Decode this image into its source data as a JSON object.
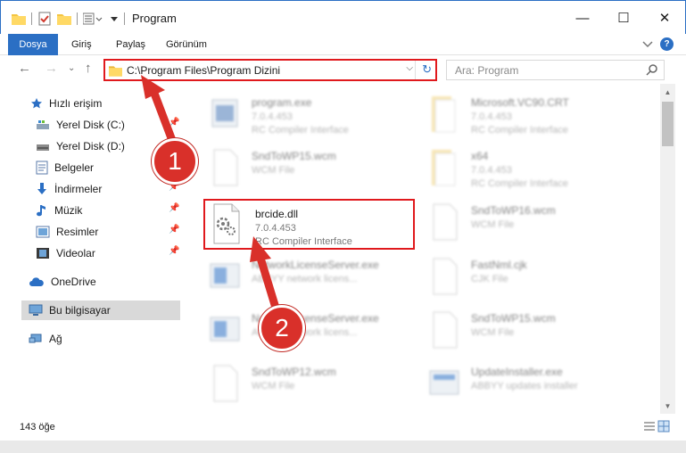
{
  "window": {
    "title": "Program",
    "controls": {
      "minimize": "—",
      "maximize": "☐",
      "close": "✕"
    }
  },
  "ribbon": {
    "tabs": [
      "Dosya",
      "Giriş",
      "Paylaş",
      "Görünüm"
    ],
    "help": "?"
  },
  "navigation": {
    "back": "←",
    "forward": "→",
    "recent": "⌄",
    "up": "↑"
  },
  "address_bar": {
    "path": "C:\\Program Files\\Program Dizini",
    "dropdown": "⌵",
    "refresh": "↻"
  },
  "search": {
    "placeholder": "Ara: Program"
  },
  "sidebar": {
    "items": [
      {
        "label": "Hızlı erişim",
        "icon": "star-icon",
        "pinned": false
      },
      {
        "label": "Yerel Disk (C:)",
        "icon": "drive-icon",
        "pinned": true
      },
      {
        "label": "Yerel Disk (D:)",
        "icon": "drive-icon",
        "pinned": true
      },
      {
        "label": "Belgeler",
        "icon": "documents-icon",
        "pinned": true
      },
      {
        "label": "İndirmeler",
        "icon": "download-icon",
        "pinned": true
      },
      {
        "label": "Müzik",
        "icon": "music-icon",
        "pinned": true
      },
      {
        "label": "Resimler",
        "icon": "pictures-icon",
        "pinned": true
      },
      {
        "label": "Videolar",
        "icon": "videos-icon",
        "pinned": true
      },
      {
        "label": "OneDrive",
        "icon": "cloud-icon",
        "pinned": false
      },
      {
        "label": "Bu bilgisayar",
        "icon": "computer-icon",
        "pinned": false
      },
      {
        "label": "Ağ",
        "icon": "network-icon",
        "pinned": false
      }
    ],
    "pin_glyph": "📌"
  },
  "files": [
    {
      "name": "program.exe",
      "meta1": "7.0.4.453",
      "meta2": "RC Compiler Interface",
      "type": "exe"
    },
    {
      "name": "Microsoft.VC90.CRT",
      "meta1": "7.0.4.453",
      "meta2": "RC Compiler Interface",
      "type": "folder"
    },
    {
      "name": "SndToWP15.wcm",
      "meta1": "WCM File",
      "meta2": "",
      "type": "doc"
    },
    {
      "name": "x64",
      "meta1": "7.0.4.453",
      "meta2": "RC Compiler Interface",
      "type": "folder"
    },
    {
      "name": "brcide.dll",
      "meta1": "7.0.4.453",
      "meta2": "RC Compiler Interface",
      "type": "dll"
    },
    {
      "name": "SndToWP16.wcm",
      "meta1": "WCM File",
      "meta2": "",
      "type": "doc"
    },
    {
      "name": "NetworkLicenseServer.exe",
      "meta1": "ABBYY network licens...",
      "meta2": "",
      "type": "app"
    },
    {
      "name": "FastNml.cjk",
      "meta1": "CJK File",
      "meta2": "",
      "type": "doc"
    },
    {
      "name": "NetworkLicenseServer.exe",
      "meta1": "ABBYY network licens...",
      "meta2": "",
      "type": "app"
    },
    {
      "name": "SndToWP15.wcm",
      "meta1": "WCM File",
      "meta2": "",
      "type": "doc"
    },
    {
      "name": "SndToWP12.wcm",
      "meta1": "WCM File",
      "meta2": "",
      "type": "doc"
    },
    {
      "name": "UpdateInstaller.exe",
      "meta1": "ABBYY updates installer",
      "meta2": "",
      "type": "app"
    }
  ],
  "status": {
    "count": "143 öğe"
  },
  "annotations": {
    "step1": "1",
    "step2": "2",
    "color": "#d9302a"
  }
}
